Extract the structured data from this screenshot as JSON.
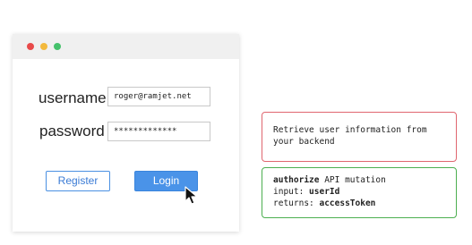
{
  "window": {
    "controls": [
      "close",
      "minimize",
      "maximize"
    ],
    "control_colors": {
      "close": "#e84a4a",
      "minimize": "#f3b93d",
      "maximize": "#45c16b"
    }
  },
  "form": {
    "username_label": "username",
    "username_value": "roger@ramjet.net",
    "password_label": "password",
    "password_value": "*************",
    "register_label": "Register",
    "login_label": "Login"
  },
  "notes": {
    "backend": {
      "line1": "Retrieve user information from",
      "line2": "your backend",
      "border_color": "#e0666f"
    },
    "api": {
      "keyword": "authorize",
      "line1_rest": " API mutation",
      "input_label": "input: ",
      "input_value": "userId",
      "returns_label": "returns: ",
      "returns_value": "accessToken",
      "border_color": "#4caf50"
    }
  },
  "accent_color": "#4a93e8"
}
